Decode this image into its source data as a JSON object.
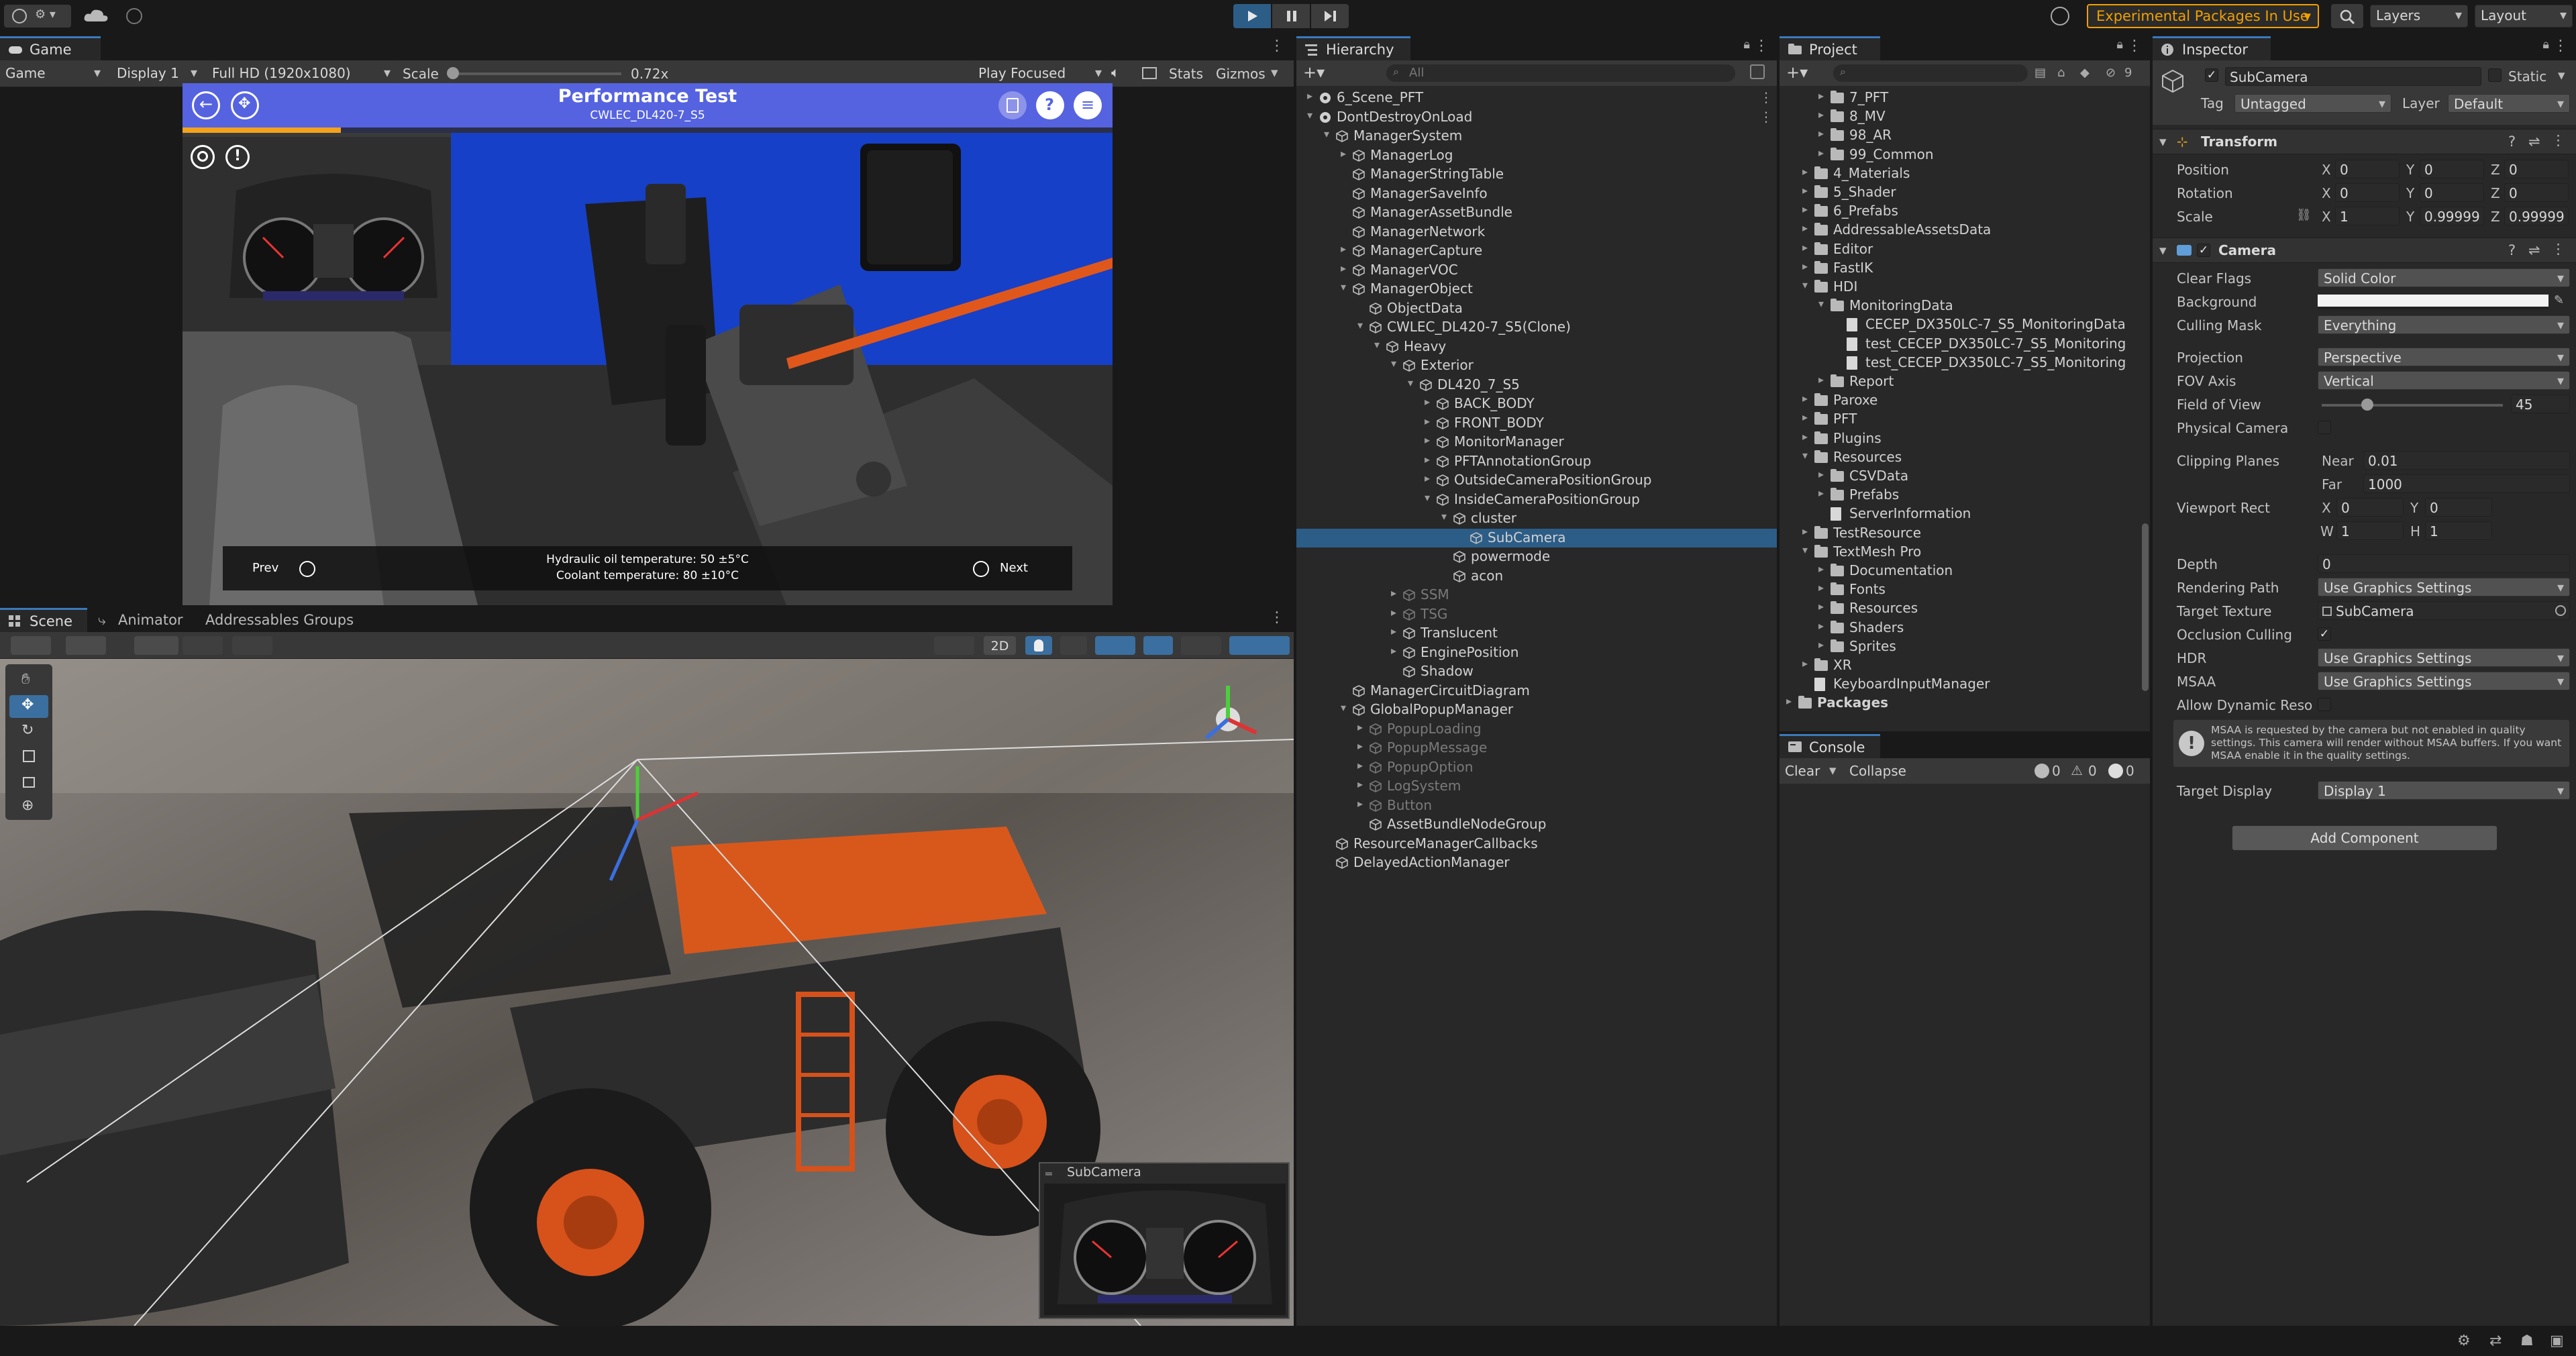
{
  "topbar": {
    "account_icon": "account-icon",
    "cloud_icon": "cloud-icon",
    "collab_icon": "collab-icon",
    "play_icon": "play-icon",
    "pause_icon": "pause-icon",
    "step_icon": "step-icon",
    "history_icon": "history-icon",
    "experimental_label": "Experimental Packages In Use",
    "search_icon": "search-icon",
    "layers_label": "Layers",
    "layout_label": "Layout",
    "accent": "#3a79bb",
    "warning_color": "#f0a000"
  },
  "game": {
    "tab_label": "Game",
    "display_dd": "Game",
    "display_label": "Display 1",
    "resolution_label": "Full HD (1920x1080)",
    "scale_label": "Scale",
    "scale_value": "0.72x",
    "play_focused": "Play Focused",
    "stats_label": "Stats",
    "gizmos_label": "Gizmos",
    "app": {
      "title": "Performance Test",
      "subtitle": "CWLEC_DL420-7_S5",
      "prev_label": "Prev",
      "next_label": "Next",
      "caption_line1": "Hydraulic oil temperature: 50 ±5°C",
      "caption_line2": "Coolant temperature: 80 ±10°C",
      "progress": 0.17,
      "header_color": "#5563e0"
    }
  },
  "scene": {
    "tabs": [
      "Scene",
      "Animator",
      "Addressables Groups"
    ],
    "toggle_2d": "2D",
    "subcamera_preview_title": "SubCamera",
    "tools": [
      "hand-icon",
      "move-icon",
      "rotate-icon",
      "scale-icon",
      "rect-icon",
      "transform-icon"
    ]
  },
  "hierarchy": {
    "tab_label": "Hierarchy",
    "search_placeholder": "All",
    "rows": [
      {
        "label": "6_Scene_PFT",
        "depth": 0,
        "arrow": "▸",
        "icon": "scene",
        "dim": false
      },
      {
        "label": "DontDestroyOnLoad",
        "depth": 0,
        "arrow": "▾",
        "icon": "scene",
        "dim": false
      },
      {
        "label": "ManagerSystem",
        "depth": 1,
        "arrow": "▾",
        "icon": "cube",
        "dim": false
      },
      {
        "label": "ManagerLog",
        "depth": 2,
        "arrow": "▸",
        "icon": "cube",
        "dim": false
      },
      {
        "label": "ManagerStringTable",
        "depth": 2,
        "arrow": "",
        "icon": "cube",
        "dim": false
      },
      {
        "label": "ManagerSaveInfo",
        "depth": 2,
        "arrow": "",
        "icon": "cube",
        "dim": false
      },
      {
        "label": "ManagerAssetBundle",
        "depth": 2,
        "arrow": "",
        "icon": "cube",
        "dim": false
      },
      {
        "label": "ManagerNetwork",
        "depth": 2,
        "arrow": "",
        "icon": "cube",
        "dim": false
      },
      {
        "label": "ManagerCapture",
        "depth": 2,
        "arrow": "▸",
        "icon": "cube",
        "dim": false
      },
      {
        "label": "ManagerVOC",
        "depth": 2,
        "arrow": "▸",
        "icon": "cube",
        "dim": false
      },
      {
        "label": "ManagerObject",
        "depth": 2,
        "arrow": "▾",
        "icon": "cube",
        "dim": false
      },
      {
        "label": "ObjectData",
        "depth": 3,
        "arrow": "",
        "icon": "cube",
        "dim": false
      },
      {
        "label": "CWLEC_DL420-7_S5(Clone)",
        "depth": 3,
        "arrow": "▾",
        "icon": "cube",
        "dim": false
      },
      {
        "label": "Heavy",
        "depth": 4,
        "arrow": "▾",
        "icon": "cube",
        "dim": false
      },
      {
        "label": "Exterior",
        "depth": 5,
        "arrow": "▾",
        "icon": "cube",
        "dim": false
      },
      {
        "label": "DL420_7_S5",
        "depth": 6,
        "arrow": "▾",
        "icon": "cube",
        "dim": false
      },
      {
        "label": "BACK_BODY",
        "depth": 7,
        "arrow": "▸",
        "icon": "cube",
        "dim": false
      },
      {
        "label": "FRONT_BODY",
        "depth": 7,
        "arrow": "▸",
        "icon": "cube",
        "dim": false
      },
      {
        "label": "MonitorManager",
        "depth": 7,
        "arrow": "▸",
        "icon": "cube",
        "dim": false
      },
      {
        "label": "PFTAnnotationGroup",
        "depth": 7,
        "arrow": "▸",
        "icon": "cube",
        "dim": false
      },
      {
        "label": "OutsideCameraPositionGroup",
        "depth": 7,
        "arrow": "▸",
        "icon": "cube",
        "dim": false
      },
      {
        "label": "InsideCameraPositionGroup",
        "depth": 7,
        "arrow": "▾",
        "icon": "cube",
        "dim": false
      },
      {
        "label": "cluster",
        "depth": 8,
        "arrow": "▾",
        "icon": "cube",
        "dim": false
      },
      {
        "label": "SubCamera",
        "depth": 9,
        "arrow": "",
        "icon": "cube",
        "dim": false,
        "selected": true
      },
      {
        "label": "powermode",
        "depth": 8,
        "arrow": "",
        "icon": "cube",
        "dim": false
      },
      {
        "label": "acon",
        "depth": 8,
        "arrow": "",
        "icon": "cube",
        "dim": false
      },
      {
        "label": "SSM",
        "depth": 5,
        "arrow": "▸",
        "icon": "cube",
        "dim": true
      },
      {
        "label": "TSG",
        "depth": 5,
        "arrow": "▸",
        "icon": "cube",
        "dim": true
      },
      {
        "label": "Translucent",
        "depth": 5,
        "arrow": "▸",
        "icon": "cube",
        "dim": false
      },
      {
        "label": "EnginePosition",
        "depth": 5,
        "arrow": "▸",
        "icon": "cube",
        "dim": false
      },
      {
        "label": "Shadow",
        "depth": 5,
        "arrow": "",
        "icon": "cube",
        "dim": false
      },
      {
        "label": "ManagerCircuitDiagram",
        "depth": 2,
        "arrow": "",
        "icon": "cube",
        "dim": false
      },
      {
        "label": "GlobalPopupManager",
        "depth": 2,
        "arrow": "▾",
        "icon": "cube",
        "dim": false
      },
      {
        "label": "PopupLoading",
        "depth": 3,
        "arrow": "▸",
        "icon": "cube",
        "dim": true
      },
      {
        "label": "PopupMessage",
        "depth": 3,
        "arrow": "▸",
        "icon": "cube",
        "dim": true
      },
      {
        "label": "PopupOption",
        "depth": 3,
        "arrow": "▸",
        "icon": "cube",
        "dim": true
      },
      {
        "label": "LogSystem",
        "depth": 3,
        "arrow": "▸",
        "icon": "cube",
        "dim": true
      },
      {
        "label": "Button",
        "depth": 3,
        "arrow": "▸",
        "icon": "cube",
        "dim": true
      },
      {
        "label": "AssetBundleNodeGroup",
        "depth": 3,
        "arrow": "",
        "icon": "cube",
        "dim": false
      },
      {
        "label": "ResourceManagerCallbacks",
        "depth": 1,
        "arrow": "",
        "icon": "cube",
        "dim": false
      },
      {
        "label": "DelayedActionManager",
        "depth": 1,
        "arrow": "",
        "icon": "cube",
        "dim": false
      }
    ]
  },
  "project": {
    "tab_label": "Project",
    "hidden_count": "9",
    "rows": [
      {
        "label": "7_PFT",
        "depth": 2,
        "arrow": "▸",
        "icon": "folder"
      },
      {
        "label": "8_MV",
        "depth": 2,
        "arrow": "▸",
        "icon": "folder"
      },
      {
        "label": "98_AR",
        "depth": 2,
        "arrow": "▸",
        "icon": "folder"
      },
      {
        "label": "99_Common",
        "depth": 2,
        "arrow": "▸",
        "icon": "folder"
      },
      {
        "label": "4_Materials",
        "depth": 1,
        "arrow": "▸",
        "icon": "folder"
      },
      {
        "label": "5_Shader",
        "depth": 1,
        "arrow": "▸",
        "icon": "folder"
      },
      {
        "label": "6_Prefabs",
        "depth": 1,
        "arrow": "▸",
        "icon": "folder"
      },
      {
        "label": "AddressableAssetsData",
        "depth": 1,
        "arrow": "▸",
        "icon": "folder"
      },
      {
        "label": "Editor",
        "depth": 1,
        "arrow": "▸",
        "icon": "folder"
      },
      {
        "label": "FastIK",
        "depth": 1,
        "arrow": "▸",
        "icon": "folder"
      },
      {
        "label": "HDI",
        "depth": 1,
        "arrow": "▾",
        "icon": "folder"
      },
      {
        "label": "MonitoringData",
        "depth": 2,
        "arrow": "▾",
        "icon": "folder"
      },
      {
        "label": "CECEP_DX350LC-7_S5_MonitoringData",
        "depth": 3,
        "arrow": "",
        "icon": "file"
      },
      {
        "label": "test_CECEP_DX350LC-7_S5_Monitoring",
        "depth": 3,
        "arrow": "",
        "icon": "file"
      },
      {
        "label": "test_CECEP_DX350LC-7_S5_Monitoring",
        "depth": 3,
        "arrow": "",
        "icon": "file"
      },
      {
        "label": "Report",
        "depth": 2,
        "arrow": "▸",
        "icon": "folder"
      },
      {
        "label": "Paroxe",
        "depth": 1,
        "arrow": "▸",
        "icon": "folder"
      },
      {
        "label": "PFT",
        "depth": 1,
        "arrow": "▸",
        "icon": "folder"
      },
      {
        "label": "Plugins",
        "depth": 1,
        "arrow": "▸",
        "icon": "folder"
      },
      {
        "label": "Resources",
        "depth": 1,
        "arrow": "▾",
        "icon": "folder"
      },
      {
        "label": "CSVData",
        "depth": 2,
        "arrow": "▸",
        "icon": "folder"
      },
      {
        "label": "Prefabs",
        "depth": 2,
        "arrow": "▸",
        "icon": "folder"
      },
      {
        "label": "ServerInformation",
        "depth": 2,
        "arrow": "",
        "icon": "file"
      },
      {
        "label": "TestResource",
        "depth": 1,
        "arrow": "▸",
        "icon": "folder"
      },
      {
        "label": "TextMesh Pro",
        "depth": 1,
        "arrow": "▾",
        "icon": "folder"
      },
      {
        "label": "Documentation",
        "depth": 2,
        "arrow": "▸",
        "icon": "folder"
      },
      {
        "label": "Fonts",
        "depth": 2,
        "arrow": "▸",
        "icon": "folder"
      },
      {
        "label": "Resources",
        "depth": 2,
        "arrow": "▸",
        "icon": "folder"
      },
      {
        "label": "Shaders",
        "depth": 2,
        "arrow": "▸",
        "icon": "folder"
      },
      {
        "label": "Sprites",
        "depth": 2,
        "arrow": "▸",
        "icon": "folder"
      },
      {
        "label": "XR",
        "depth": 1,
        "arrow": "▸",
        "icon": "folder"
      },
      {
        "label": "KeyboardInputManager",
        "depth": 1,
        "arrow": "",
        "icon": "file"
      },
      {
        "label": "Packages",
        "depth": 0,
        "arrow": "▸",
        "icon": "folder",
        "bold": true
      }
    ]
  },
  "console": {
    "tab_label": "Console",
    "clear_label": "Clear",
    "collapse_label": "Collapse",
    "info_count": "0",
    "warn_count": "0",
    "error_count": "0"
  },
  "inspector": {
    "tab_label": "Inspector",
    "object_name": "SubCamera",
    "static_label": "Static",
    "tag_label": "Tag",
    "tag_value": "Untagged",
    "layer_label": "Layer",
    "layer_value": "Default",
    "transform": {
      "title": "Transform",
      "position_label": "Position",
      "rotation_label": "Rotation",
      "scale_label": "Scale",
      "position": [
        "0",
        "0",
        "0"
      ],
      "rotation": [
        "0",
        "0",
        "0"
      ],
      "scale": [
        "1",
        "0.99999",
        "0.99999"
      ]
    },
    "camera": {
      "title": "Camera",
      "clear_flags_label": "Clear Flags",
      "clear_flags": "Solid Color",
      "background_label": "Background",
      "culling_mask_label": "Culling Mask",
      "culling_mask": "Everything",
      "projection_label": "Projection",
      "projection": "Perspective",
      "fov_axis_label": "FOV Axis",
      "fov_axis": "Vertical",
      "fov_label": "Field of View",
      "fov_value": "45",
      "fov_fraction": 0.25,
      "physical_label": "Physical Camera",
      "clipping_label": "Clipping Planes",
      "near_label": "Near",
      "near_value": "0.01",
      "far_label": "Far",
      "far_value": "1000",
      "viewport_label": "Viewport Rect",
      "vp_x": "0",
      "vp_y": "0",
      "vp_w": "1",
      "vp_h": "1",
      "depth_label": "Depth",
      "depth_value": "0",
      "rendering_path_label": "Rendering Path",
      "rendering_path": "Use Graphics Settings",
      "target_texture_label": "Target Texture",
      "target_texture": "SubCamera",
      "occlusion_label": "Occlusion Culling",
      "hdr_label": "HDR",
      "hdr_value": "Use Graphics Settings",
      "msaa_label": "MSAA",
      "msaa_value": "Use Graphics Settings",
      "dyn_res_label": "Allow Dynamic Resolution",
      "msaa_warning": "MSAA is requested by the camera but not enabled in quality settings. This camera will render without MSAA buffers. If you want MSAA enable it in the quality settings.",
      "target_display_label": "Target Display",
      "target_display": "Display 1"
    },
    "add_component": "Add Component"
  }
}
